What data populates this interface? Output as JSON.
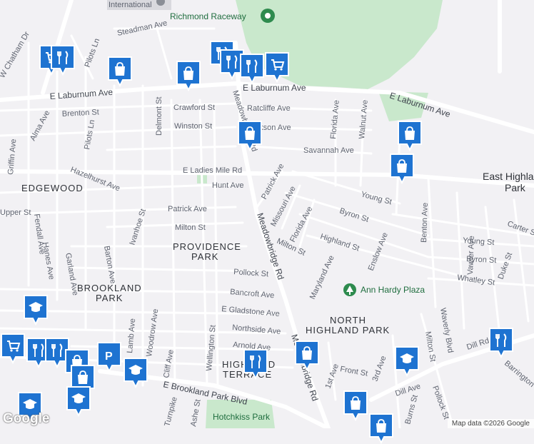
{
  "map": {
    "neighborhoods": [
      "EDGEWOOD",
      "PROVIDENCE",
      "PARK",
      "BROOKLAND",
      "PARK",
      "NORTH",
      "HIGHLAND PARK",
      "HIGHLAND",
      "TERRACE",
      "East Highland",
      "Park"
    ],
    "pois": {
      "raceway": "Richmond Raceway",
      "international": "International",
      "plaza": "Ann Hardy Plaza",
      "hotchkiss": "Hotchkiss Park"
    },
    "streets": {
      "e_laburnum_1": "E Laburnum Ave",
      "e_laburnum_2": "E Laburnum Ave",
      "e_laburnum_3": "E Laburnum Ave",
      "steadman": "Steadman Ave",
      "w_chatham": "W Chatham Dr",
      "pilots_ln_1": "Pilots Ln",
      "pilots_ln_2": "Pilots Ln",
      "brenton": "Brenton St",
      "alma": "Alma Ave",
      "crawford": "Crawford St",
      "ratcliffe": "Ratcliffe Ave",
      "winston": "Winston St",
      "jackson": "Jackson Ave",
      "delmont": "Delmont St",
      "griffin": "Griffin Ave",
      "hazelhurst": "Hazelhurst Ave",
      "e_ladies_mile": "E Ladies Mile Rd",
      "savannah": "Savannah Ave",
      "hunt": "Hunt Ave",
      "patrick_ave_1": "Patrick Ave",
      "patrick_ave_2": "Patrick Ave",
      "milton_1": "Milton St",
      "milton_2": "Milton St",
      "ivanhoe": "Ivanhoe St",
      "fendall": "Fendall Ave",
      "hanes": "Hanes Ave",
      "garland": "Garland Ave",
      "barton": "Barton Ave",
      "pollock": "Pollock St",
      "bancroft": "Bancroft Ave",
      "e_gladstone": "E Gladstone Ave",
      "northside": "Northside Ave",
      "arnold": "Arnold Ave",
      "wellington": "Wellington St",
      "cliff": "Cliff Ave",
      "woodrow": "Woodrow Ave",
      "lamb": "Lamb Ave",
      "e_brookland_park": "E Brookland Park Blvd",
      "meadowbridge_1": "Meadowbridge Rd",
      "meadowbridge_2": "Meadowbridge Rd",
      "meadowbridge_3": "Meadowbridge Rd",
      "missouri": "Missouri Ave",
      "florida_1": "Florida Ave",
      "florida_2": "Florida Ave",
      "walnut": "Walnut Ave",
      "young_1": "Young St",
      "young_2": "Young St",
      "byron_1": "Byron St",
      "byron_2": "Byron St",
      "highland": "Highland St",
      "enslow": "Enslow Ave",
      "maryland": "Maryland Ave",
      "whatley": "Whatley St",
      "duke": "Duke St",
      "carter": "Carter St",
      "vawter": "Vawter Ave",
      "benton": "Benton Ave",
      "waverly": "Waverly Blvd",
      "milton_st_3": "Milton St",
      "dill_rd": "Dill Rd",
      "dill_ave": "Dill Ave",
      "pollock_st_2": "Pollock St",
      "barrington": "Barrington Rd",
      "third_ave": "3rd Ave",
      "first_ave": "1st Ave",
      "front": "Front St",
      "burns": "Burns St",
      "upper": "Upper St",
      "turnpike": "Turnpike",
      "ashe": "Ashe St"
    },
    "attribution": "Map data ©2026 Google",
    "logo": "Google"
  },
  "markers": [
    {
      "type": "grocery",
      "icon": "grocery-icon"
    },
    {
      "type": "restaurant",
      "icon": "restaurant-icon"
    },
    {
      "type": "shopping",
      "icon": "shopping-bag-icon"
    },
    {
      "type": "shopping",
      "icon": "shopping-bag-icon"
    },
    {
      "type": "restaurant",
      "icon": "restaurant-icon"
    },
    {
      "type": "restaurant",
      "icon": "restaurant-icon"
    },
    {
      "type": "restaurant",
      "icon": "restaurant-icon"
    },
    {
      "type": "grocery",
      "icon": "grocery-icon"
    },
    {
      "type": "shopping",
      "icon": "shopping-bag-icon"
    },
    {
      "type": "shopping",
      "icon": "shopping-bag-icon"
    },
    {
      "type": "shopping",
      "icon": "shopping-bag-icon"
    },
    {
      "type": "school",
      "icon": "school-icon"
    },
    {
      "type": "grocery",
      "icon": "grocery-icon"
    },
    {
      "type": "restaurant",
      "icon": "restaurant-icon"
    },
    {
      "type": "restaurant",
      "icon": "restaurant-icon"
    },
    {
      "type": "shopping",
      "icon": "shopping-bag-icon"
    },
    {
      "type": "parking",
      "icon": "parking-icon"
    },
    {
      "type": "shopping",
      "icon": "shopping-bag-icon"
    },
    {
      "type": "school",
      "icon": "school-icon"
    },
    {
      "type": "school",
      "icon": "school-icon"
    },
    {
      "type": "school",
      "icon": "school-icon"
    },
    {
      "type": "restaurant",
      "icon": "restaurant-icon"
    },
    {
      "type": "shopping",
      "icon": "shopping-bag-icon"
    },
    {
      "type": "school",
      "icon": "school-icon"
    },
    {
      "type": "shopping",
      "icon": "shopping-bag-icon"
    },
    {
      "type": "restaurant",
      "icon": "restaurant-icon"
    },
    {
      "type": "shopping",
      "icon": "shopping-bag-icon"
    }
  ],
  "colors": {
    "background": "#f2f1f4",
    "park": "#c9e8cc",
    "road": "#ffffff",
    "marker_fill": "#1e73d1",
    "marker_border": "#ffffff"
  }
}
